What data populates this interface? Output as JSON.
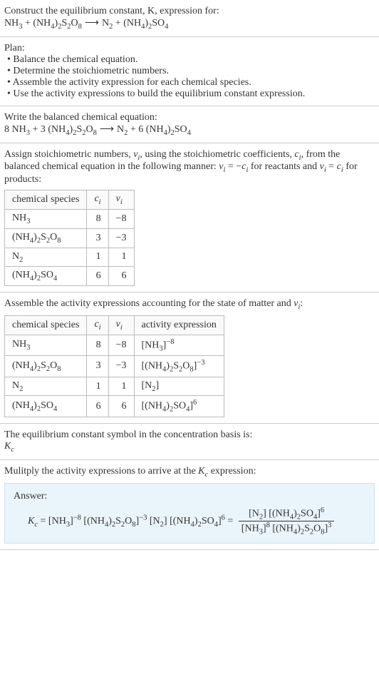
{
  "header": {
    "prompt": "Construct the equilibrium constant, K, expression for:",
    "equation_lhs1": "NH",
    "equation_lhs1_sub": "3",
    "equation_plus1": " + (NH",
    "equation_lhs2_sub1": "4",
    "equation_lhs2_mid": ")",
    "equation_lhs2_sub2": "2",
    "equation_lhs2_s": "S",
    "equation_lhs2_sub3": "2",
    "equation_lhs2_o": "O",
    "equation_lhs2_sub4": "8",
    "arrow": " ⟶ ",
    "equation_rhs1": "N",
    "equation_rhs1_sub": "2",
    "equation_plus2": " + (NH",
    "equation_rhs2_sub1": "4",
    "equation_rhs2_mid": ")",
    "equation_rhs2_sub2": "2",
    "equation_rhs2_so": "SO",
    "equation_rhs2_sub3": "4"
  },
  "plan": {
    "title": "Plan:",
    "items": [
      "Balance the chemical equation.",
      "Determine the stoichiometric numbers.",
      "Assemble the activity expression for each chemical species.",
      "Use the activity expressions to build the equilibrium constant expression."
    ]
  },
  "balanced": {
    "intro": "Write the balanced chemical equation:",
    "c1": "8 NH",
    "c1sub": "3",
    "plus1": " + 3 (NH",
    "c2sub1": "4",
    "c2mid": ")",
    "c2sub2": "2",
    "c2s": "S",
    "c2sub3": "2",
    "c2o": "O",
    "c2sub4": "8",
    "arrow": " ⟶ ",
    "r1": "N",
    "r1sub": "2",
    "plus2": " + 6 (NH",
    "r2sub1": "4",
    "r2mid": ")",
    "r2sub2": "2",
    "r2so": "SO",
    "r2sub3": "4"
  },
  "stoich": {
    "intro1": "Assign stoichiometric numbers, ",
    "nu": "ν",
    "isub": "i",
    "intro2": ", using the stoichiometric coefficients, ",
    "c": "c",
    "intro3": ", from the balanced chemical equation in the following manner: ",
    "rel1": " = −",
    "intro4": " for reactants and ",
    "rel2": " = ",
    "intro5": " for products:",
    "th_species": "chemical species",
    "th_c": "c",
    "th_nu": "ν",
    "rows": [
      {
        "sp_a": "NH",
        "sp_b": "3",
        "sp_c": "",
        "sp_d": "",
        "sp_e": "",
        "sp_f": "",
        "sp_g": "",
        "sp_h": "",
        "sp_i": "",
        "c": "8",
        "nu": "−8"
      },
      {
        "sp_a": "(NH",
        "sp_b": "4",
        "sp_c": ")",
        "sp_d": "2",
        "sp_e": "S",
        "sp_f": "2",
        "sp_g": "O",
        "sp_h": "8",
        "sp_i": "",
        "c": "3",
        "nu": "−3"
      },
      {
        "sp_a": "N",
        "sp_b": "2",
        "sp_c": "",
        "sp_d": "",
        "sp_e": "",
        "sp_f": "",
        "sp_g": "",
        "sp_h": "",
        "sp_i": "",
        "c": "1",
        "nu": "1"
      },
      {
        "sp_a": "(NH",
        "sp_b": "4",
        "sp_c": ")",
        "sp_d": "2",
        "sp_e": "SO",
        "sp_f": "4",
        "sp_g": "",
        "sp_h": "",
        "sp_i": "",
        "c": "6",
        "nu": "6"
      }
    ]
  },
  "activity": {
    "intro1": "Assemble the activity expressions accounting for the state of matter and ",
    "nu": "ν",
    "isub": "i",
    "colon": ":",
    "th_species": "chemical species",
    "th_c": "c",
    "th_nu": "ν",
    "th_act": "activity expression",
    "rows": [
      {
        "sp_a": "NH",
        "sp_b": "3",
        "sp_c": "",
        "sp_d": "",
        "sp_e": "",
        "sp_f": "",
        "sp_g": "",
        "sp_h": "",
        "c": "8",
        "nu": "−8",
        "ae_a": "[NH",
        "ae_b": "3",
        "ae_c": "]",
        "ae_exp": "−8",
        "ae_d": "",
        "ae_e": "",
        "ae_f": "",
        "ae_g": "",
        "ae_h": ""
      },
      {
        "sp_a": "(NH",
        "sp_b": "4",
        "sp_c": ")",
        "sp_d": "2",
        "sp_e": "S",
        "sp_f": "2",
        "sp_g": "O",
        "sp_h": "8",
        "c": "3",
        "nu": "−3",
        "ae_a": "[(NH",
        "ae_b": "4",
        "ae_c": ")",
        "ae_d": "2",
        "ae_e": "S",
        "ae_f": "2",
        "ae_g": "O",
        "ae_h": "8",
        "ae_i": "]",
        "ae_exp": "−3"
      },
      {
        "sp_a": "N",
        "sp_b": "2",
        "sp_c": "",
        "sp_d": "",
        "sp_e": "",
        "sp_f": "",
        "sp_g": "",
        "sp_h": "",
        "c": "1",
        "nu": "1",
        "ae_a": "[N",
        "ae_b": "2",
        "ae_c": "]",
        "ae_exp": "",
        "ae_d": "",
        "ae_e": "",
        "ae_f": "",
        "ae_g": "",
        "ae_h": ""
      },
      {
        "sp_a": "(NH",
        "sp_b": "4",
        "sp_c": ")",
        "sp_d": "2",
        "sp_e": "SO",
        "sp_f": "4",
        "sp_g": "",
        "sp_h": "",
        "c": "6",
        "nu": "6",
        "ae_a": "[(NH",
        "ae_b": "4",
        "ae_c": ")",
        "ae_d": "2",
        "ae_e": "SO",
        "ae_f": "4",
        "ae_g": "]",
        "ae_exp": "6",
        "ae_h": ""
      }
    ]
  },
  "symbol": {
    "text": "The equilibrium constant symbol in the concentration basis is:",
    "k": "K",
    "ksub": "c"
  },
  "multiply": {
    "intro1": "Mulitply the activity expressions to arrive at the ",
    "k": "K",
    "ksub": "c",
    "intro2": " expression:"
  },
  "answer": {
    "label": "Answer:",
    "k": "K",
    "ksub": "c",
    "eq": " = ",
    "t1a": "[NH",
    "t1b": "3",
    "t1c": "]",
    "t1exp": "−8",
    "sp": " ",
    "t2a": "[(NH",
    "t2b": "4",
    "t2c": ")",
    "t2d": "2",
    "t2e": "S",
    "t2f": "2",
    "t2g": "O",
    "t2h": "8",
    "t2i": "]",
    "t2exp": "−3",
    "t3a": "[N",
    "t3b": "2",
    "t3c": "]",
    "t4a": "[(NH",
    "t4b": "4",
    "t4c": ")",
    "t4d": "2",
    "t4e": "SO",
    "t4f": "4",
    "t4g": "]",
    "t4exp": "6",
    "eq2": " = ",
    "num_a": "[N",
    "num_b": "2",
    "num_c": "] [(NH",
    "num_d": "4",
    "num_e": ")",
    "num_f": "2",
    "num_g": "SO",
    "num_h": "4",
    "num_i": "]",
    "num_exp": "6",
    "den_a": "[NH",
    "den_b": "3",
    "den_c": "]",
    "den_exp1": "8",
    "den_d": " [(NH",
    "den_e": "4",
    "den_f": ")",
    "den_g": "2",
    "den_h": "S",
    "den_i": "2",
    "den_j": "O",
    "den_k": "8",
    "den_l": "]",
    "den_exp2": "3"
  }
}
